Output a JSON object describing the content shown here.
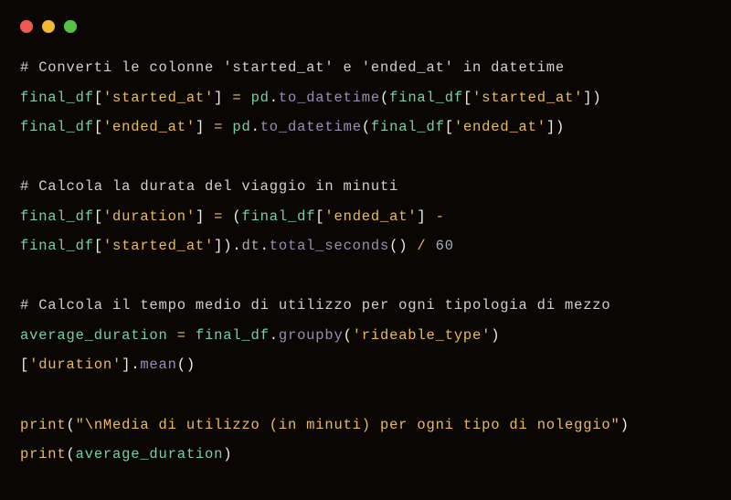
{
  "code": {
    "comment1": "# Converti le colonne 'started_at' e 'ended_at' in datetime",
    "line1_var1": "final_df",
    "line1_str1": "'started_at'",
    "line1_var2": "pd",
    "line1_func1": "to_datetime",
    "line1_var3": "final_df",
    "line1_str2": "'started_at'",
    "line2_var1": "final_df",
    "line2_str1": "'ended_at'",
    "line2_var2": "pd",
    "line2_func1": "to_datetime",
    "line2_var3": "final_df",
    "line2_str2": "'ended_at'",
    "comment2": "# Calcola la durata del viaggio in minuti",
    "line3_var1": "final_df",
    "line3_str1": "'duration'",
    "line3_var2": "final_df",
    "line3_str2": "'ended_at'",
    "line4_var1": "final_df",
    "line4_str1": "'started_at'",
    "line4_attr1": "dt",
    "line4_func1": "total_seconds",
    "line4_num1": "60",
    "comment3": "# Calcola il tempo medio di utilizzo per ogni tipologia di mezzo",
    "line5_var1": "average_duration",
    "line5_var2": "final_df",
    "line5_func1": "groupby",
    "line5_str1": "'rideable_type'",
    "line6_str1": "'duration'",
    "line6_func1": "mean",
    "line7_kw": "print",
    "line7_str": "\"\\nMedia di utilizzo (in minuti) per ogni tipo di noleggio\"",
    "line8_kw": "print",
    "line8_var": "average_duration"
  }
}
